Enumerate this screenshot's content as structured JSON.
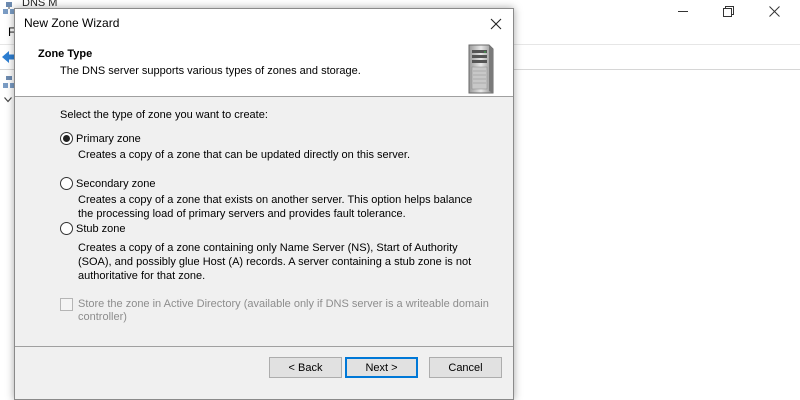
{
  "background_app": {
    "title": "DNS M",
    "menu": [
      "F"
    ]
  },
  "dialog": {
    "title": "New Zone Wizard",
    "header_title": "Zone Type",
    "header_subtitle": "The DNS server supports various types of zones and storage.",
    "prompt": "Select the type of zone you want to create:",
    "options": [
      {
        "label": "Primary zone",
        "selected": true,
        "description": [
          "Creates a copy of a zone that can be updated directly on this server."
        ]
      },
      {
        "label": "Secondary zone",
        "selected": false,
        "description": [
          "Creates a copy of a zone that exists on another server. This option helps balance",
          "the processing load of primary servers and provides fault tolerance."
        ]
      },
      {
        "label": "Stub zone",
        "selected": false,
        "description": [
          "Creates a copy of a zone containing only Name Server (NS), Start of Authority",
          "(SOA), and possibly glue Host (A) records. A server containing a stub zone is not",
          "authoritative for that zone."
        ]
      }
    ],
    "store_ad": {
      "label_lines": [
        "Store the zone in Active Directory (available only if DNS server is a writeable domain",
        "controller)"
      ],
      "checked": false,
      "enabled": false
    },
    "buttons": {
      "back": "< Back",
      "next": "Next >",
      "cancel": "Cancel"
    }
  },
  "icons": [
    "dns-app-icon",
    "minimize-icon",
    "maximize-icon",
    "close-icon",
    "back-arrow-icon",
    "server-icon",
    "chevron-down-icon"
  ],
  "colors": {
    "accent": "#0078d7",
    "dialog_bg": "#f0f0f0",
    "disabled_text": "#8d8d8d"
  }
}
